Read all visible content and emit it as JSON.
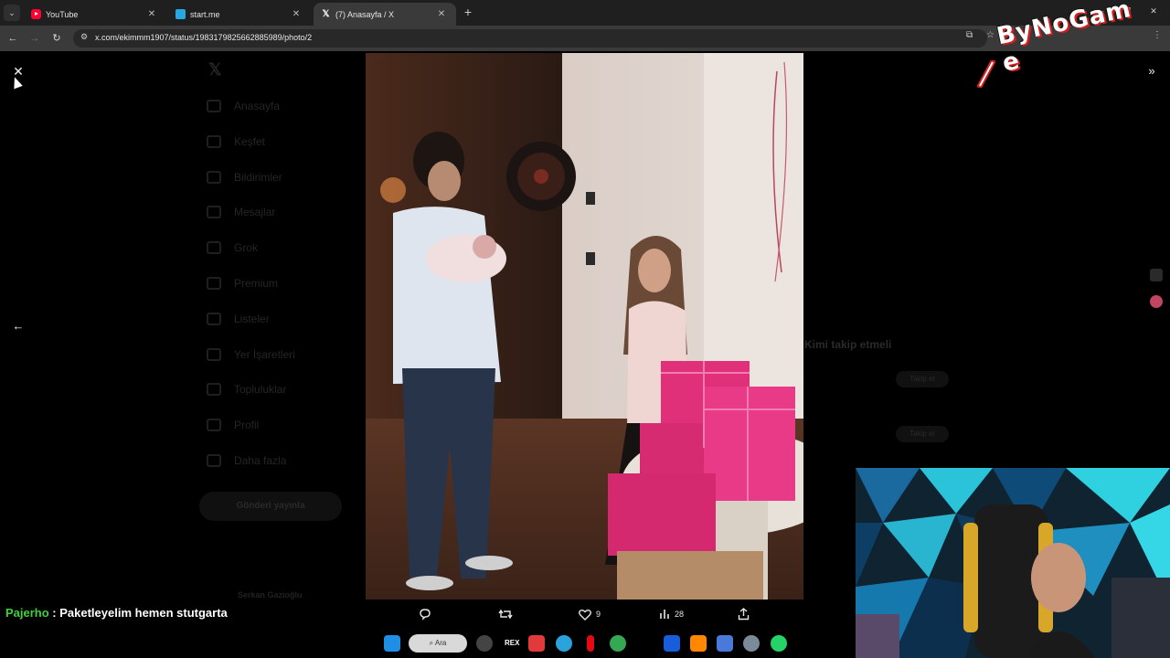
{
  "browser": {
    "tabs": [
      {
        "label": "YouTube",
        "icon": "youtube-icon",
        "active": false
      },
      {
        "label": "start.me",
        "icon": "startme-icon",
        "active": false
      },
      {
        "label": "(7) Anasayfa / X",
        "icon": "x-logo-icon",
        "active": true
      }
    ],
    "url": "x.com/ekimmm1907/status/1983179825662885989/photo/2"
  },
  "x_page": {
    "nav": [
      "Anasayfa",
      "Keşfet",
      "Bildirimler",
      "Mesajlar",
      "Grok",
      "Premium",
      "Listeler",
      "Yer İşaretleri",
      "Topluluklar",
      "Profil",
      "Daha fazla"
    ],
    "post_button": "Gönderi yayınla",
    "user_name": "Serkan Gazioğlu",
    "right_heading": "Kimi takip etmeli",
    "follow_label": "Takip et"
  },
  "media_actions": {
    "reply": {
      "icon": "reply-icon",
      "count": ""
    },
    "repost": {
      "icon": "repost-icon",
      "count": ""
    },
    "like": {
      "icon": "heart-icon",
      "count": "9"
    },
    "views": {
      "icon": "views-icon",
      "count": "28"
    },
    "share": {
      "icon": "share-icon",
      "count": ""
    }
  },
  "chat": {
    "user": "Pajerho",
    "message": " : Paketleyelim hemen stutgarta"
  },
  "taskbar": {
    "search_label": "Ara",
    "app_text": "REX"
  },
  "overlay_logo": {
    "text": "ByNoGam e"
  },
  "colors": {
    "accent_green": "#3fd23a",
    "gift_pink": "#e0307a",
    "brand_red": "#d21e1e"
  }
}
